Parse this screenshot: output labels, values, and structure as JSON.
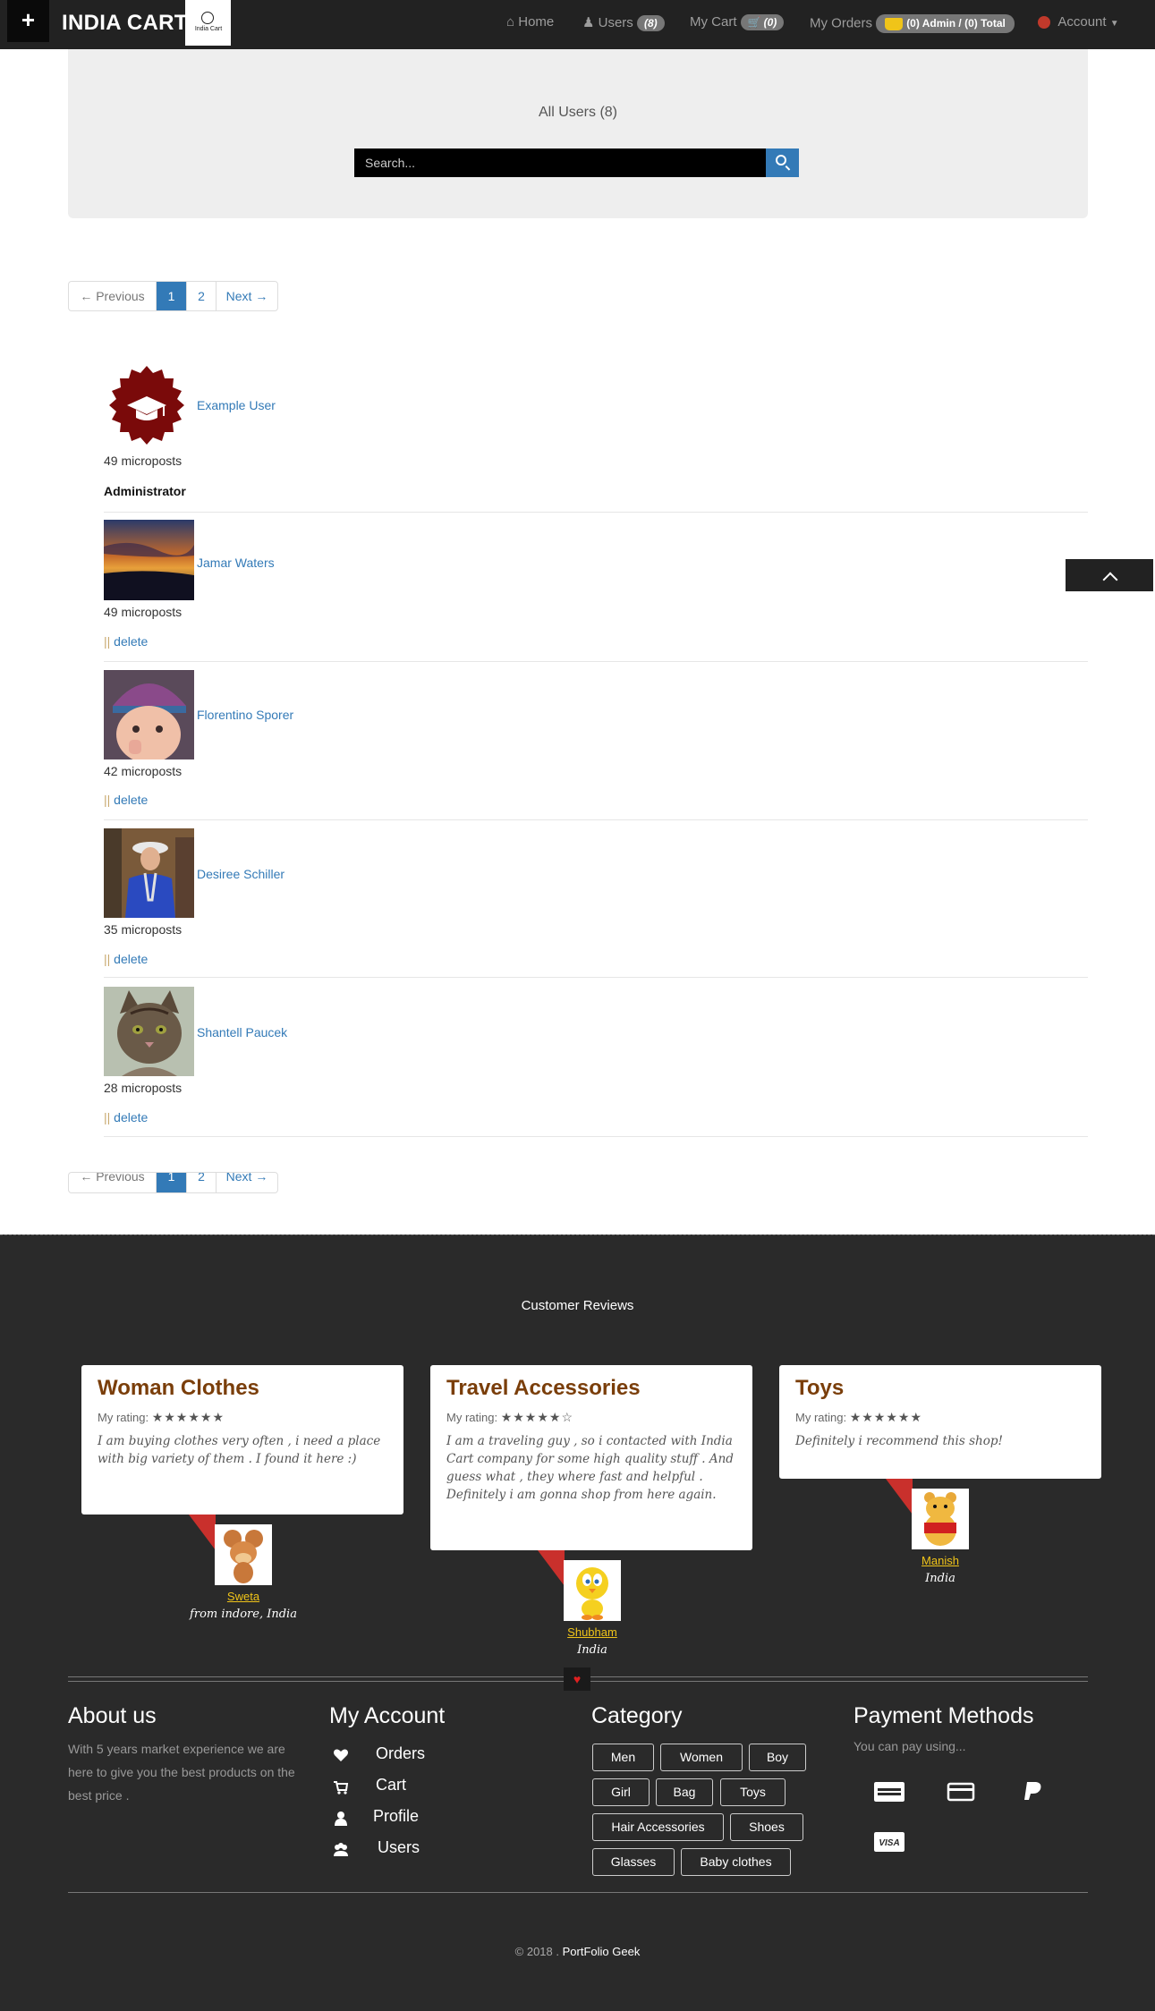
{
  "navbar": {
    "plus_label": "+",
    "brand": "INDIA CART",
    "logo_text": "India Cart",
    "home": "Home",
    "users": "Users",
    "users_count": "(8)",
    "my_cart": "My Cart",
    "cart_count": "(0)",
    "my_orders": "My Orders",
    "orders_summary": "(0) Admin / (0) Total",
    "account": "Account"
  },
  "header": {
    "title": "All Users (8)",
    "search_placeholder": "Search..."
  },
  "pagination": {
    "previous": "← Previous",
    "pages": [
      "1",
      "2"
    ],
    "next": "Next →",
    "current_page": "1"
  },
  "users": [
    {
      "name": "Example User",
      "microposts": "49 microposts",
      "role": "Administrator"
    },
    {
      "name": "Jamar Waters",
      "microposts": "49 microposts",
      "action_sep": "||",
      "action": "delete"
    },
    {
      "name": "Florentino Sporer",
      "microposts": "42 microposts",
      "action_sep": "||",
      "action": "delete"
    },
    {
      "name": "Desiree Schiller",
      "microposts": "35 microposts",
      "action_sep": "||",
      "action": "delete"
    },
    {
      "name": "Shantell Paucek",
      "microposts": "28 microposts",
      "action_sep": "||",
      "action": "delete"
    }
  ],
  "reviews": {
    "title": "Customer Reviews",
    "rating_label": "My rating:",
    "items": [
      {
        "title": "Woman Clothes",
        "rating": 6,
        "stars": "★★★★★★",
        "text": "I am buying clothes very often , i need a place with big variety of them . I found it here :)",
        "reviewer": "Sweta",
        "location": "from indore, India"
      },
      {
        "title": "Travel Accessories",
        "rating": 5,
        "stars": "★★★★★☆",
        "text": "I am a traveling guy , so i contacted with India Cart company for some high quality stuff . And guess what , they where fast and helpful . Definitely i am gonna shop from here again.",
        "reviewer": "Shubham",
        "location": "India"
      },
      {
        "title": "Toys",
        "rating": 6,
        "stars": "★★★★★★",
        "text": "Definitely i recommend this shop!",
        "reviewer": "Manish",
        "location": "India"
      }
    ]
  },
  "footer": {
    "about_title": "About us",
    "about_text": "With 5 years market experience we are here to give you the best products on the best price .",
    "account_title": "My Account",
    "account_links": [
      "Orders",
      "Cart",
      "Profile",
      "Users"
    ],
    "category_title": "Category",
    "categories": [
      "Men",
      "Women",
      "Boy",
      "Girl",
      "Bag",
      "Toys",
      "Hair Accessories",
      "Shoes",
      "Glasses",
      "Baby clothes"
    ],
    "payment_title": "Payment Methods",
    "payment_text": "You can pay using...",
    "payment_methods": [
      "american-express-icon",
      "credit-card-icon",
      "paypal-icon",
      "visa-icon"
    ],
    "visa_label": "VISA",
    "copyright_prefix": "© 2018 .",
    "copyright_owner": "PortFolio Geek",
    "heart": "♥"
  },
  "colors": {
    "navbar_bg": "#222222",
    "link": "#337ab7",
    "footer_bg": "#2a2a2a",
    "review_title": "#7a3e0a",
    "reviewer_name": "#f0c419"
  }
}
